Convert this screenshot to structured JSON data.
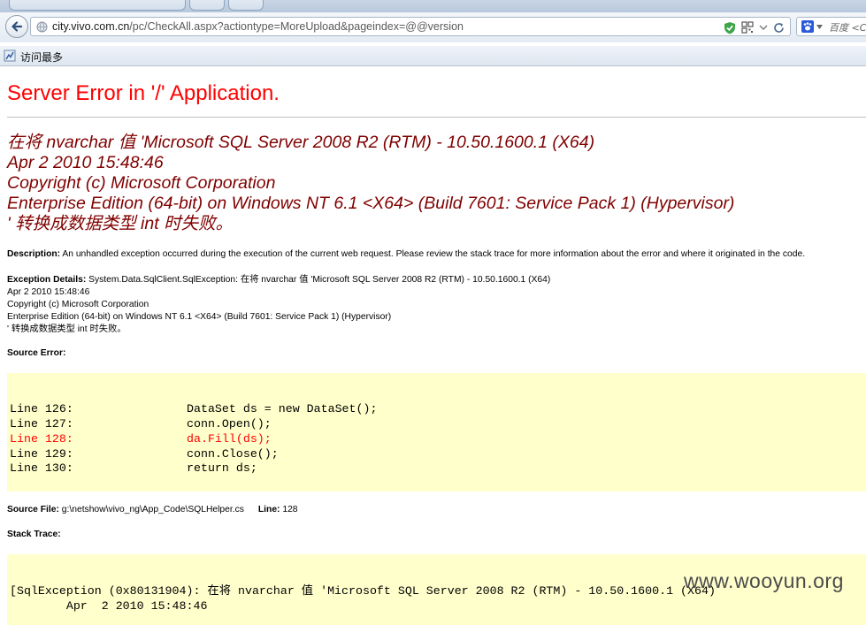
{
  "browser": {
    "url_host": "city.vivo.com.cn",
    "url_path": "/pc/CheckAll.aspx?actiontype=MoreUpload&pageindex=@@version",
    "search_engine_label": "百度 <C",
    "bookmark_label": "访问最多"
  },
  "page": {
    "title": "Server Error in '/' Application.",
    "error_message_lines": [
      "在将 nvarchar 值 'Microsoft SQL Server 2008 R2 (RTM) - 10.50.1600.1 (X64)",
      "Apr  2 2010 15:48:46",
      "Copyright (c) Microsoft Corporation",
      "Enterprise Edition (64-bit) on Windows NT 6.1 <X64> (Build 7601: Service Pack 1) (Hypervisor)",
      "' 转换成数据类型 int 时失败。"
    ],
    "description_label": "Description:",
    "description_text": " An unhandled exception occurred during the execution of the current web request. Please review the stack trace for more information about the error and where it originated in the code.",
    "exception_label": "Exception Details:",
    "exception_first": " System.Data.SqlClient.SqlException: 在将 nvarchar 值 'Microsoft SQL Server 2008 R2 (RTM) - 10.50.1600.1 (X64)",
    "exception_lines": [
      "Apr  2 2010 15:48:46",
      "Copyright (c) Microsoft Corporation",
      "Enterprise Edition (64-bit) on Windows NT 6.1 <X64> (Build 7601: Service Pack 1) (Hypervisor)",
      "' 转换成数据类型 int 时失败。"
    ],
    "source_error_label": "Source Error:",
    "source_lines": [
      {
        "num": "Line 126:",
        "code": "DataSet ds = new DataSet();"
      },
      {
        "num": "Line 127:",
        "code": "conn.Open();"
      },
      {
        "num": "Line 128:",
        "code": "da.Fill(ds);"
      },
      {
        "num": "Line 129:",
        "code": "conn.Close();"
      },
      {
        "num": "Line 130:",
        "code": "return ds;"
      }
    ],
    "source_file_label": "Source File:",
    "source_file_value": " g:\\netshow\\vivo_ng\\App_Code\\SQLHelper.cs",
    "line_label": "Line:",
    "line_value": " 128",
    "stack_trace_label": "Stack Trace:",
    "stack_lines": [
      "[SqlException (0x80131904): 在将 nvarchar 值 'Microsoft SQL Server 2008 R2 (RTM) - 10.50.1600.1 (X64)",
      "        Apr  2 2010 15:48:46"
    ]
  },
  "watermark": "www.wooyun.org",
  "colors": {
    "title_red": "#ff0000",
    "message_maroon": "#800000",
    "code_background": "#ffffcc",
    "highlight_line_red": "#ff0000"
  }
}
